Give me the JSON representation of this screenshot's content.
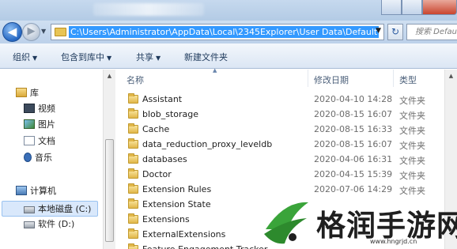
{
  "address_bar": {
    "path": "C:\\Users\\Administrator\\AppData\\Local\\2345Explorer\\User Data\\Default",
    "search_placeholder": "搜索 Defau",
    "back_glyph": "◀",
    "forward_glyph": "▶"
  },
  "toolbar": {
    "organize": "组织",
    "include_in_library": "包含到库中",
    "share": "共享",
    "new_folder": "新建文件夹"
  },
  "nav_pane": {
    "libraries": "库",
    "library_items": [
      "视频",
      "图片",
      "文档",
      "音乐"
    ],
    "computer": "计算机",
    "drives": [
      "本地磁盘 (C:)",
      "软件 (D:)"
    ],
    "selected": "本地磁盘 (C:)"
  },
  "columns": {
    "name": "名称",
    "modified": "修改日期",
    "type": "类型"
  },
  "files": [
    {
      "name": "Assistant",
      "modified": "2020-04-10 14:28",
      "type": "文件夹"
    },
    {
      "name": "blob_storage",
      "modified": "2020-08-15 16:07",
      "type": "文件夹"
    },
    {
      "name": "Cache",
      "modified": "2020-08-15 16:33",
      "type": "文件夹"
    },
    {
      "name": "data_reduction_proxy_leveldb",
      "modified": "2020-08-15 16:07",
      "type": "文件夹"
    },
    {
      "name": "databases",
      "modified": "2020-04-06 16:31",
      "type": "文件夹"
    },
    {
      "name": "Doctor",
      "modified": "2020-04-15 15:39",
      "type": "文件夹"
    },
    {
      "name": "Extension Rules",
      "modified": "2020-07-06 14:29",
      "type": "文件夹"
    },
    {
      "name": "Extension State",
      "modified": "",
      "type": ""
    },
    {
      "name": "Extensions",
      "modified": "",
      "type": ""
    },
    {
      "name": "ExternalExtensions",
      "modified": "",
      "type": ""
    },
    {
      "name": "Feature Engagement Tracker",
      "modified": "",
      "type": ""
    }
  ],
  "watermark": {
    "text": "格润手游网",
    "url": "www.hngrjd.cn",
    "color_green": "#3aa43a"
  }
}
